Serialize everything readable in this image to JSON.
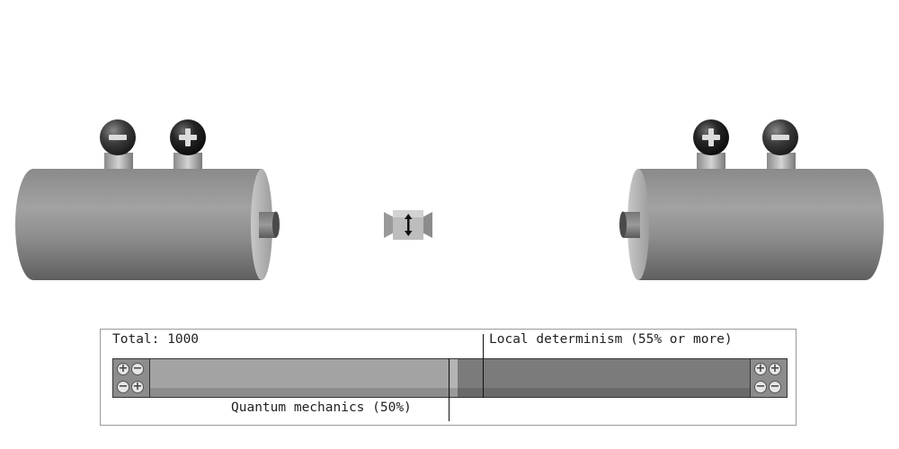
{
  "detector_left": {
    "terminals": [
      "−",
      "+"
    ]
  },
  "detector_right": {
    "terminals": [
      "+",
      "−"
    ]
  },
  "source": {
    "icon": "polarization-axis-icon"
  },
  "results": {
    "total_label": "Total: 1000",
    "local_threshold_label": "Local determinism (55% or more)",
    "quantum_label": "Quantum mechanics (50%)",
    "left_counter_symbols": [
      "+",
      "−",
      "−",
      "+"
    ],
    "right_counter_symbols": [
      "+",
      "+",
      "−",
      "−"
    ],
    "quantum_fraction": 0.5,
    "local_threshold_fraction": 0.55
  },
  "colors": {
    "cylinder": "#8e8e8e",
    "knob": "#1a1a1a",
    "bar_fill": "#a3a3a3",
    "bar_track": "#7b7b7b"
  }
}
